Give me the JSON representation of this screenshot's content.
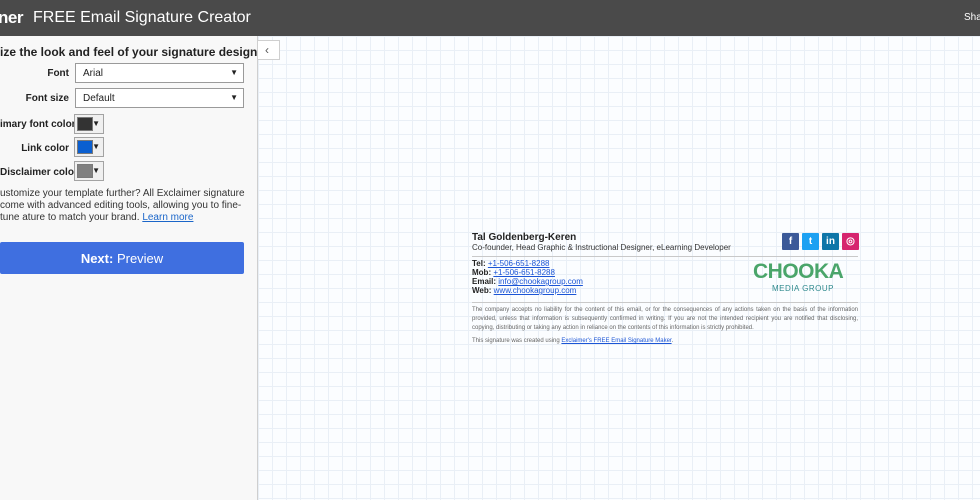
{
  "topbar": {
    "brand": "ner",
    "title": "FREE Email Signature Creator",
    "share": "Sha"
  },
  "panel": {
    "heading": "ize the look and feel of your signature design.",
    "font_label": "Font",
    "font_value": "Arial",
    "size_label": "Font size",
    "size_value": "Default",
    "primary_label": "imary font color",
    "link_label": "Link color",
    "disclaimer_label": "Disclaimer color",
    "help_text": "ustomize your template further? All Exclaimer signature come with advanced editing tools, allowing you to fine-tune ature to match your brand.",
    "learn_more": "Learn more",
    "next_prefix": "Next:",
    "next_label": " Preview"
  },
  "colors": {
    "primary_font": "#333333",
    "link": "#0b5fd0",
    "disclaimer": "#808080",
    "topbar": "#4a4a4a",
    "button": "#3f6fe0"
  },
  "signature": {
    "name": "Tal Goldenberg-Keren",
    "title": "Co-founder, Head Graphic & Instructional Designer, eLearning Developer",
    "tel_label": "Tel:",
    "tel": "+1-506-651-8288",
    "mob_label": "Mob:",
    "mob": "+1-506-651-8288",
    "email_label": "Email:",
    "email": "info@chookagroup.com",
    "web_label": "Web:",
    "web": "www.chookagroup.com",
    "logo_main": "CHOOKA",
    "logo_sub": "MEDIA GROUP",
    "disclaimer": "The company accepts no liability for the content of this email, or for the consequences of any actions taken on the basis of the information provided, unless that information is subsequently confirmed in writing. If you are not the intended recipient you are notified that disclosing, copying, distributing or taking any action in reliance on the contents of this information is strictly prohibited.",
    "created_prefix": "This signature was created using ",
    "created_link": "Exclaimer's FREE Email Signature Maker",
    "created_suffix": ".",
    "social": [
      {
        "icon": "facebook-icon",
        "glyph": "f",
        "color": "#3b5998"
      },
      {
        "icon": "twitter-icon",
        "glyph": "t",
        "color": "#1da1f2"
      },
      {
        "icon": "linkedin-icon",
        "glyph": "in",
        "color": "#0e76a8"
      },
      {
        "icon": "instagram-icon",
        "glyph": "◎",
        "color": "#d6246e"
      }
    ]
  }
}
